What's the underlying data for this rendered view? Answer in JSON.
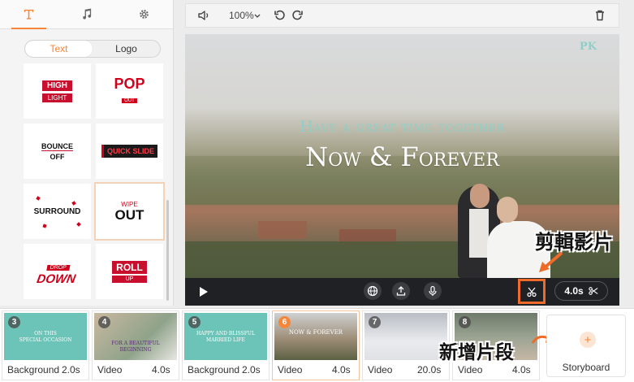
{
  "tabs": [
    {
      "icon": "text-icon",
      "active": true
    },
    {
      "icon": "music-note-icon",
      "active": false
    },
    {
      "icon": "gear-icon",
      "active": false
    }
  ],
  "segment": {
    "text_label": "Text",
    "logo_label": "Logo",
    "selected": "Text"
  },
  "templates": [
    {
      "line1": "HIGH",
      "line2": "LIGHT"
    },
    {
      "line1": "POP",
      "line2": "OUT"
    },
    {
      "line1": "BOUNCE",
      "line2": "OFF"
    },
    {
      "line1": "QUICK SLIDE"
    },
    {
      "line1": "SURROUND"
    },
    {
      "line1": "WIPE",
      "line2": "OUT",
      "selected": true
    },
    {
      "line1": "DROP",
      "line2": "DOWN"
    },
    {
      "line1": "ROLL",
      "line2": "UP"
    }
  ],
  "toolbar": {
    "zoom": "100%",
    "icons": [
      "volume-icon",
      "undo-icon",
      "redo-icon",
      "trash-icon"
    ]
  },
  "preview": {
    "logo": "PK",
    "title_line1": "Have a great time together",
    "title_line2": "Now & Forever",
    "duration": "4.0s"
  },
  "annotations": {
    "edit_clip": "剪輯影片",
    "add_clip": "新增片段"
  },
  "clips": [
    {
      "num": "3",
      "type": "Background",
      "duration": "2.0s",
      "bg": "#6cc3b7",
      "caption": "ON THIS\nSPECIAL OCCASION"
    },
    {
      "num": "4",
      "type": "Video",
      "duration": "4.0s",
      "bg": "#8fa38a",
      "caption": "FOR A BEAUTIFUL\nBEGINNING"
    },
    {
      "num": "5",
      "type": "Background",
      "duration": "2.0s",
      "bg": "#6cc3b7",
      "caption": "HAPPY AND BLISSFUL\nMARRIED LIFE"
    },
    {
      "num": "6",
      "type": "Video",
      "duration": "4.0s",
      "bg": "#9d8d76",
      "caption": "NOW & FOREVER",
      "selected": true
    },
    {
      "num": "7",
      "type": "Video",
      "duration": "20.0s",
      "bg": "#c5c9d0",
      "caption": ""
    },
    {
      "num": "8",
      "type": "Video",
      "duration": "4.0s",
      "bg": "#7f8a7a",
      "caption": ""
    }
  ],
  "storyboard": {
    "label": "Storyboard"
  },
  "colors": {
    "accent": "#f5863a",
    "highlight_box": "#ef6b2a",
    "teal": "#8fcfc7",
    "dark_bar": "#202124"
  }
}
